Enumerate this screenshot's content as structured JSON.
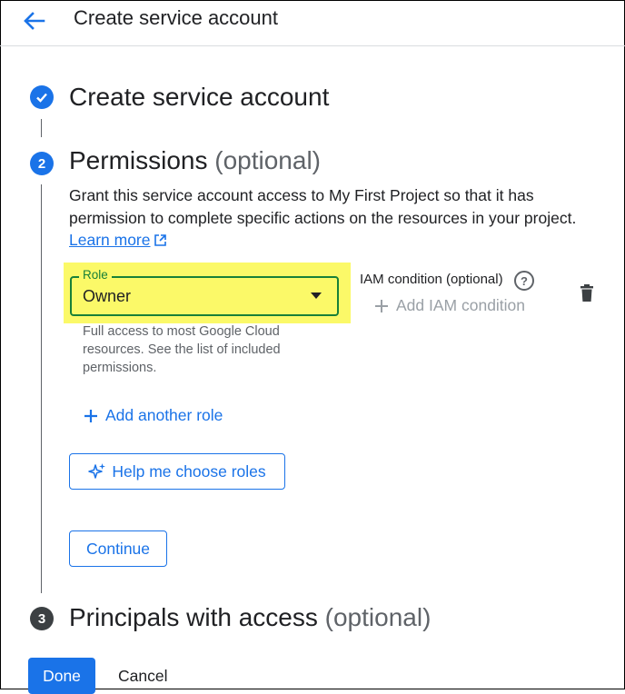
{
  "header": {
    "title": "Create service account",
    "back_icon": "arrow-back-icon"
  },
  "steps": [
    {
      "number": "",
      "title": "Create service account",
      "optional": "",
      "state": "done"
    },
    {
      "number": "2",
      "title": "Permissions",
      "optional": "(optional)",
      "state": "active"
    },
    {
      "number": "3",
      "title": "Principals with access",
      "optional": "(optional)",
      "state": "pending"
    }
  ],
  "permissions": {
    "description": "Grant this service account access to My First Project so that it has permission to complete specific actions on the resources in your project.",
    "learn_more": "Learn more",
    "role": {
      "label": "Role",
      "value": "Owner",
      "help": "Full access to most Google Cloud resources. See the list of included permissions."
    },
    "iam_condition": {
      "label": "IAM condition (optional)",
      "help_symbol": "?",
      "add_label": "Add IAM condition"
    },
    "add_another_role": "Add another role",
    "help_me_choose": "Help me choose roles",
    "continue": "Continue"
  },
  "footer": {
    "done": "Done",
    "cancel": "Cancel"
  },
  "colors": {
    "accent": "#1a73e8",
    "highlight": "#fbf968",
    "field_border": "#188038",
    "step_pending": "#3c4043"
  }
}
